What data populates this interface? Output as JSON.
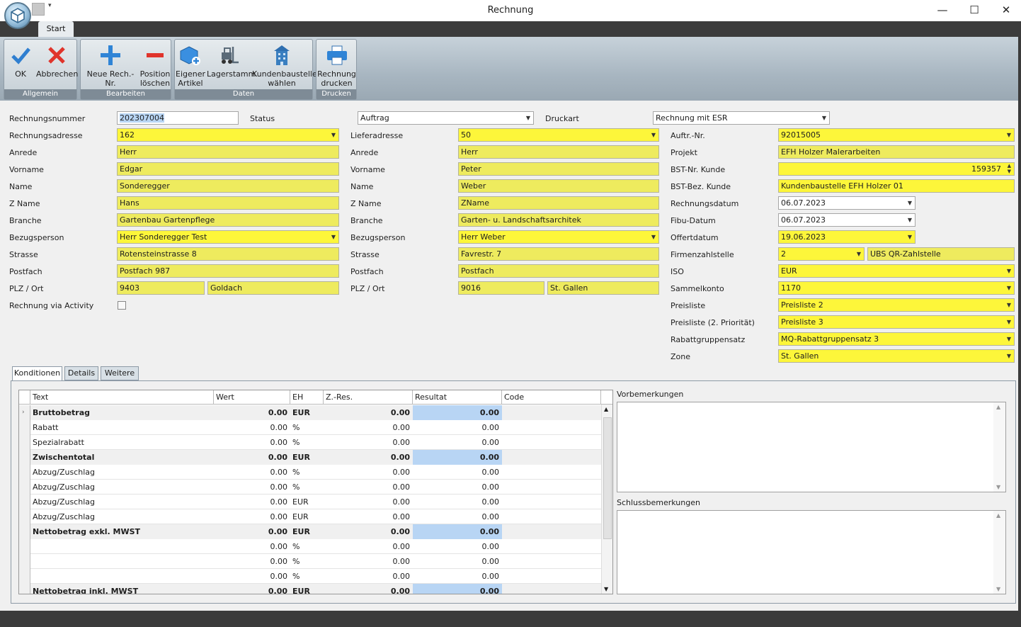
{
  "window": {
    "title": "Rechnung",
    "minimize": "—",
    "maximize": "☐",
    "close": "✕"
  },
  "ribbon": {
    "tab": "Start",
    "groups": {
      "allgemein": "Allgemein",
      "bearbeiten": "Bearbeiten",
      "daten": "Daten",
      "drucken": "Drucken"
    },
    "buttons": {
      "ok": "OK",
      "abbrechen": "Abbrechen",
      "neue_rech_1": "Neue Rech.-Nr.",
      "position_1": "Position",
      "position_2": "löschen",
      "eigener_1": "Eigener",
      "eigener_2": "Artikel",
      "lagerstamm": "Lagerstamm",
      "kundenbaustelle_1": "Kundenbaustelle",
      "kundenbaustelle_2": "wählen",
      "rechnung_1": "Rechnung",
      "rechnung_2": "drucken"
    }
  },
  "colors": {
    "required": "#eeeb5e",
    "required_select": "#fdf63a",
    "highlight": "#b8d5f4"
  },
  "form": {
    "top": {
      "rechnungsnummer_label": "Rechnungsnummer",
      "rechnungsnummer": "202307004",
      "status_label": "Status",
      "status": "Auftrag",
      "druckart_label": "Druckart",
      "druckart": "Rechnung mit ESR"
    },
    "col1": {
      "rechnungsadresse_label": "Rechnungsadresse",
      "rechnungsadresse": "162",
      "anrede_label": "Anrede",
      "anrede": "Herr",
      "vorname_label": "Vorname",
      "vorname": "Edgar",
      "name_label": "Name",
      "name": "Sonderegger",
      "zname_label": "Z Name",
      "zname": "Hans",
      "branche_label": "Branche",
      "branche": "Gartenbau Gartenpflege",
      "bezugsperson_label": "Bezugsperson",
      "bezugsperson": "Herr Sonderegger Test",
      "strasse_label": "Strasse",
      "strasse": "Rotensteinstrasse 8",
      "postfach_label": "Postfach",
      "postfach": "Postfach 987",
      "plzort_label": "PLZ / Ort",
      "plz": "9403",
      "ort": "Goldach",
      "activity_label": "Rechnung via Activity"
    },
    "col2": {
      "lieferadresse_label": "Lieferadresse",
      "lieferadresse": "50",
      "anrede_label": "Anrede",
      "anrede": "Herr",
      "vorname_label": "Vorname",
      "vorname": "Peter",
      "name_label": "Name",
      "name": "Weber",
      "zname_label": "Z Name",
      "zname": "ZName",
      "branche_label": "Branche",
      "branche": "Garten- u. Landschaftsarchitek",
      "bezugsperson_label": "Bezugsperson",
      "bezugsperson": "Herr Weber",
      "strasse_label": "Strasse",
      "strasse": "Favrestr. 7",
      "postfach_label": "Postfach",
      "postfach": "Postfach",
      "plzort_label": "PLZ / Ort",
      "plz": "9016",
      "ort": "St. Gallen"
    },
    "col3": {
      "auftr_label": "Auftr.-Nr.",
      "auftr": "92015005",
      "projekt_label": "Projekt",
      "projekt": "EFH Holzer Malerarbeiten",
      "bstnr_label": "BST-Nr. Kunde",
      "bstnr": "159357",
      "bstbez_label": "BST-Bez. Kunde",
      "bstbez": "Kundenbaustelle EFH Holzer 01",
      "rechnungsdatum_label": "Rechnungsdatum",
      "rechnungsdatum": "06.07.2023",
      "fibu_label": "Fibu-Datum",
      "fibu": "06.07.2023",
      "offert_label": "Offertdatum",
      "offert": "19.06.2023",
      "firmenzahl_label": "Firmenzahlstelle",
      "firmenzahl": "2",
      "firmenzahl_name": "UBS QR-Zahlstelle",
      "iso_label": "ISO",
      "iso": "EUR",
      "sammel_label": "Sammelkonto",
      "sammel": "1170",
      "preisliste_label": "Preisliste",
      "preisliste": "Preisliste 2",
      "preisliste2_label": "Preisliste (2. Priorität)",
      "preisliste2": "Preisliste 3",
      "rabatt_label": "Rabattgruppensatz",
      "rabatt": "MQ-Rabattgruppensatz  3",
      "zone_label": "Zone",
      "zone": "St. Gallen"
    }
  },
  "tabs": [
    "Konditionen",
    "Details",
    "Weitere"
  ],
  "grid": {
    "headers": [
      "Text",
      "Wert",
      "EH",
      "Z.-Res.",
      "Resultat",
      "Code"
    ],
    "rows": [
      {
        "text": "Bruttobetrag",
        "wert": "0.00",
        "eh": "EUR",
        "zres": "0.00",
        "res": "0.00",
        "bold": true,
        "current": true
      },
      {
        "text": "Rabatt",
        "wert": "0.00",
        "eh": "%",
        "zres": "0.00",
        "res": "0.00"
      },
      {
        "text": "Spezialrabatt",
        "wert": "0.00",
        "eh": "%",
        "zres": "0.00",
        "res": "0.00"
      },
      {
        "text": "Zwischentotal",
        "wert": "0.00",
        "eh": "EUR",
        "zres": "0.00",
        "res": "0.00",
        "bold": true
      },
      {
        "text": "Abzug/Zuschlag",
        "wert": "0.00",
        "eh": "%",
        "zres": "0.00",
        "res": "0.00"
      },
      {
        "text": "Abzug/Zuschlag",
        "wert": "0.00",
        "eh": "%",
        "zres": "0.00",
        "res": "0.00"
      },
      {
        "text": "Abzug/Zuschlag",
        "wert": "0.00",
        "eh": "EUR",
        "zres": "0.00",
        "res": "0.00"
      },
      {
        "text": "Abzug/Zuschlag",
        "wert": "0.00",
        "eh": "EUR",
        "zres": "0.00",
        "res": "0.00"
      },
      {
        "text": "Nettobetrag exkl. MWST",
        "wert": "0.00",
        "eh": "EUR",
        "zres": "0.00",
        "res": "0.00",
        "bold": true
      },
      {
        "text": "",
        "wert": "0.00",
        "eh": "%",
        "zres": "0.00",
        "res": "0.00"
      },
      {
        "text": "",
        "wert": "0.00",
        "eh": "%",
        "zres": "0.00",
        "res": "0.00"
      },
      {
        "text": "",
        "wert": "0.00",
        "eh": "%",
        "zres": "0.00",
        "res": "0.00"
      },
      {
        "text": "Nettobetrag inkl. MWST",
        "wert": "0.00",
        "eh": "EUR",
        "zres": "0.00",
        "res": "0.00",
        "bold": true
      }
    ]
  },
  "memos": {
    "vor_label": "Vorbemerkungen",
    "schluss_label": "Schlussbemerkungen"
  }
}
